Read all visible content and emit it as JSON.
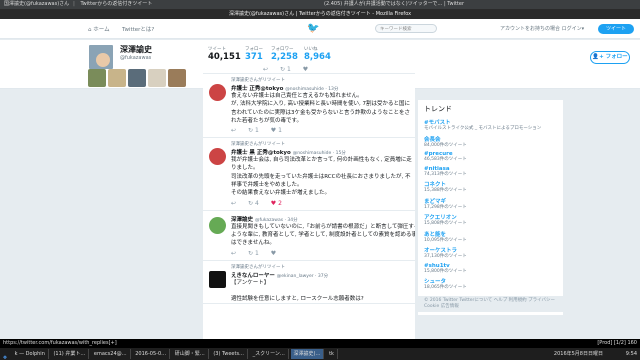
{
  "browser": {
    "tabs": [
      "国澤諭史(@fukazawas)さん",
      "Twitterからの返信付きツイート"
    ],
    "window_title": "深澤諭史(@fukazawas)さん | Twitterからの返信付きツイート - Mozilla Firefox",
    "tab_extra": "(2.405) 弁護人が(弁護活動ではなく)ツイッターで… | Twitter"
  },
  "nav": {
    "home": "ホーム",
    "about": "Twitterとは?",
    "search_placeholder": "キーワード検索",
    "account": "アカウントをお持ちの場合 ログイン▾",
    "tweet_button": "ツイート"
  },
  "profile": {
    "name": "深澤諭史",
    "handle": "@fukazawas",
    "stats": [
      {
        "label": "ツイート",
        "value": "40,151"
      },
      {
        "label": "フォロー",
        "value": "371"
      },
      {
        "label": "フォロワー",
        "value": "2,258"
      },
      {
        "label": "いいね",
        "value": "8,964"
      }
    ],
    "follow_button": "フォロー"
  },
  "tweets": [
    {
      "retweet_by": "深澤諭史さんがリツイート",
      "name": "弁護士 正秀@tokyo",
      "handle": "@noshimasuhide · 13分",
      "lines": [
        "食えない弁護士は自己責任と言えるかも知れません。",
        "が, 法科大学院に入り, 高い授業料と長い時間を使い, 7割は受かると国に",
        "言われていたのに実際は3ケ金も受からないと言う詐欺のようなことをさ",
        "れた若者たちが気の毒です。"
      ],
      "reply": "↩",
      "retweets": "↻ 1",
      "likes": "♥ 1"
    },
    {
      "retweet_by": "深澤諭史さんがリツイート",
      "name": "弁護士 黒 正秀@tokyo",
      "handle": "@noshimasuhide · 15分",
      "lines": [
        "我が弁護士会は, 自ら司法改革とか言って, 何の計画性もなく, 定員増に走",
        "りました。",
        "司法改革の先頭を走っていた弁護士はRCCの社長におさまりましたが, 不",
        "祥事で弁護士をやめました。",
        "その結果食えない弁護士が増えました。"
      ],
      "reply": "↩",
      "retweets": "↻ 4",
      "likes": "♥ 2"
    },
    {
      "retweet_by": "",
      "name": "深澤諭史",
      "handle": "@fukazawas · 34分",
      "lines": [
        "直接見聞きもしていないのに,「お前らが請書の根源だ」と断言して弾圧する",
        "ような輩に, 教育者として, 学者として, 制度設計者としての素質を認める事",
        "はできませんね。"
      ],
      "reply": "↩",
      "retweets": "↻ 1",
      "likes": "♥"
    },
    {
      "retweet_by": "深澤諭史さんがリツイート",
      "name": "えきなんローヤー",
      "handle": "@ekinan_lawyer · 37分",
      "lines": [
        "【アンケート】",
        "",
        "適性試験を任意にしますと, ロースクール志願者数は?"
      ],
      "reply": "",
      "retweets": "",
      "likes": ""
    }
  ],
  "trends": {
    "title": "トレンド",
    "items": [
      {
        "name": "#モバスト",
        "desc": "モバイルストライク公式 _ モバストによるプロモーション"
      },
      {
        "name": "会長会",
        "desc": "84,000件のツイート"
      },
      {
        "name": "#precure",
        "desc": "46,583件のツイート"
      },
      {
        "name": "#nitiasa",
        "desc": "74,313件のツイート"
      },
      {
        "name": "コネクト",
        "desc": "15,388件のツイート"
      },
      {
        "name": "まどマギ",
        "desc": "17,298件のツイート"
      },
      {
        "name": "アクエリオン",
        "desc": "15,808件のツイート"
      },
      {
        "name": "あと能を",
        "desc": "10,095件のツイート"
      },
      {
        "name": "オーケストラ",
        "desc": "37,130件のツイート"
      },
      {
        "name": "#shu1tv",
        "desc": "15,800件のツイート"
      },
      {
        "name": "シュータ",
        "desc": "18,065件のツイート"
      }
    ],
    "footer": "© 2016 Twitter  Twitterについて  ヘルプ 利用規約 プライバシー Cookie 広告情報"
  },
  "statusbar": {
    "url": "https://twitter.com/fukazawas/with_replies[+]",
    "right": "[Prod]   [1/2]   160"
  },
  "taskbar": {
    "apps": [
      "k — Dolphin",
      "(11) 弁業ト…",
      "emacs24@…",
      "2016-05-0…",
      "研山脚・緊…",
      "(3) Tweets…",
      "_スクリーン…",
      "深澤諭史(…",
      "tk"
    ],
    "active_index": 7,
    "date": "2016年5月8日日曜日",
    "time": "9:54"
  }
}
